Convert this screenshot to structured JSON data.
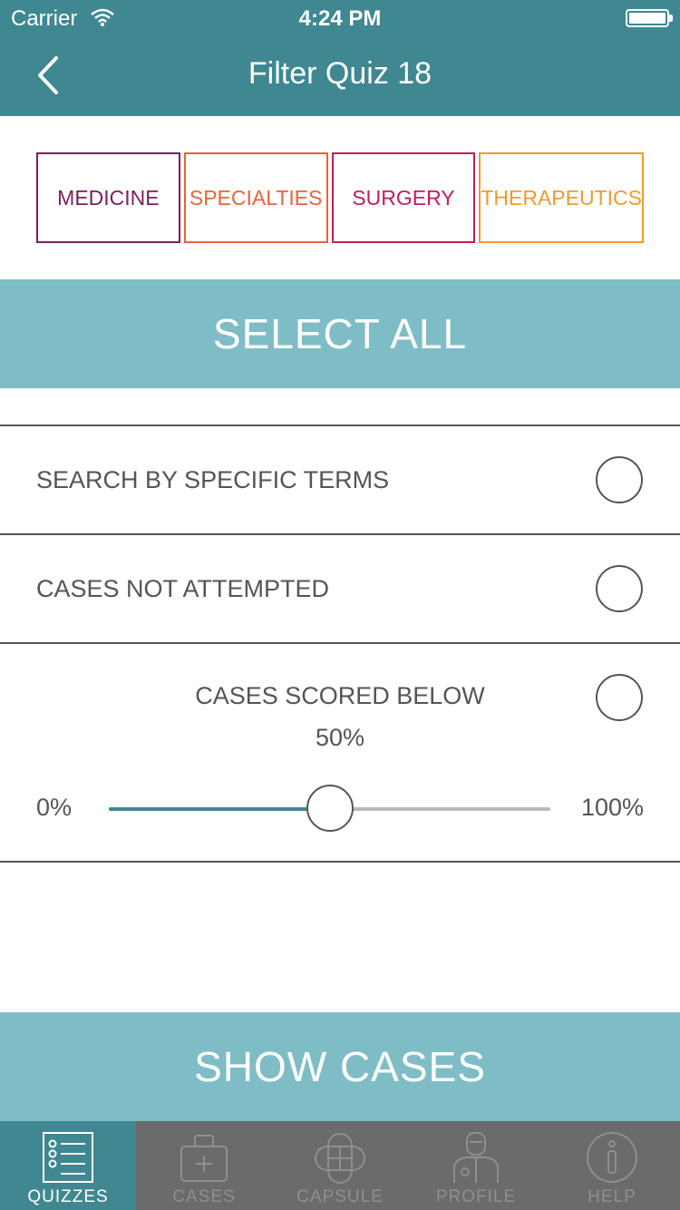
{
  "status_bar": {
    "carrier": "Carrier",
    "time": "4:24 PM"
  },
  "nav": {
    "title": "Filter Quiz 18"
  },
  "categories": [
    {
      "label": "MEDICINE",
      "color": "#7a1f5c"
    },
    {
      "label": "SPECIALTIES",
      "color": "#e8643a"
    },
    {
      "label": "SURGERY",
      "color": "#c21d5b"
    },
    {
      "label": "THERAPEUTICS",
      "color": "#f09a2e"
    }
  ],
  "select_all_label": "SELECT ALL",
  "options": {
    "search_terms": "SEARCH BY SPECIFIC TERMS",
    "not_attempted": "CASES NOT ATTEMPTED",
    "scored_below": "CASES SCORED BELOW"
  },
  "slider": {
    "value_label": "50%",
    "value": 0.5,
    "min_label": "0%",
    "max_label": "100%"
  },
  "show_cases_label": "SHOW CASES",
  "tabs": [
    {
      "label": "QUIZZES",
      "icon": "quiz-list-icon",
      "active": true
    },
    {
      "label": "CASES",
      "icon": "medical-bag-icon",
      "active": false
    },
    {
      "label": "CAPSULE",
      "icon": "capsule-icon",
      "active": false
    },
    {
      "label": "PROFILE",
      "icon": "doctor-profile-icon",
      "active": false
    },
    {
      "label": "HELP",
      "icon": "info-icon",
      "active": false
    }
  ],
  "colors": {
    "header": "#3f8891",
    "accent_light": "#7fbdc6",
    "tab_bar": "#6b6b6b"
  }
}
